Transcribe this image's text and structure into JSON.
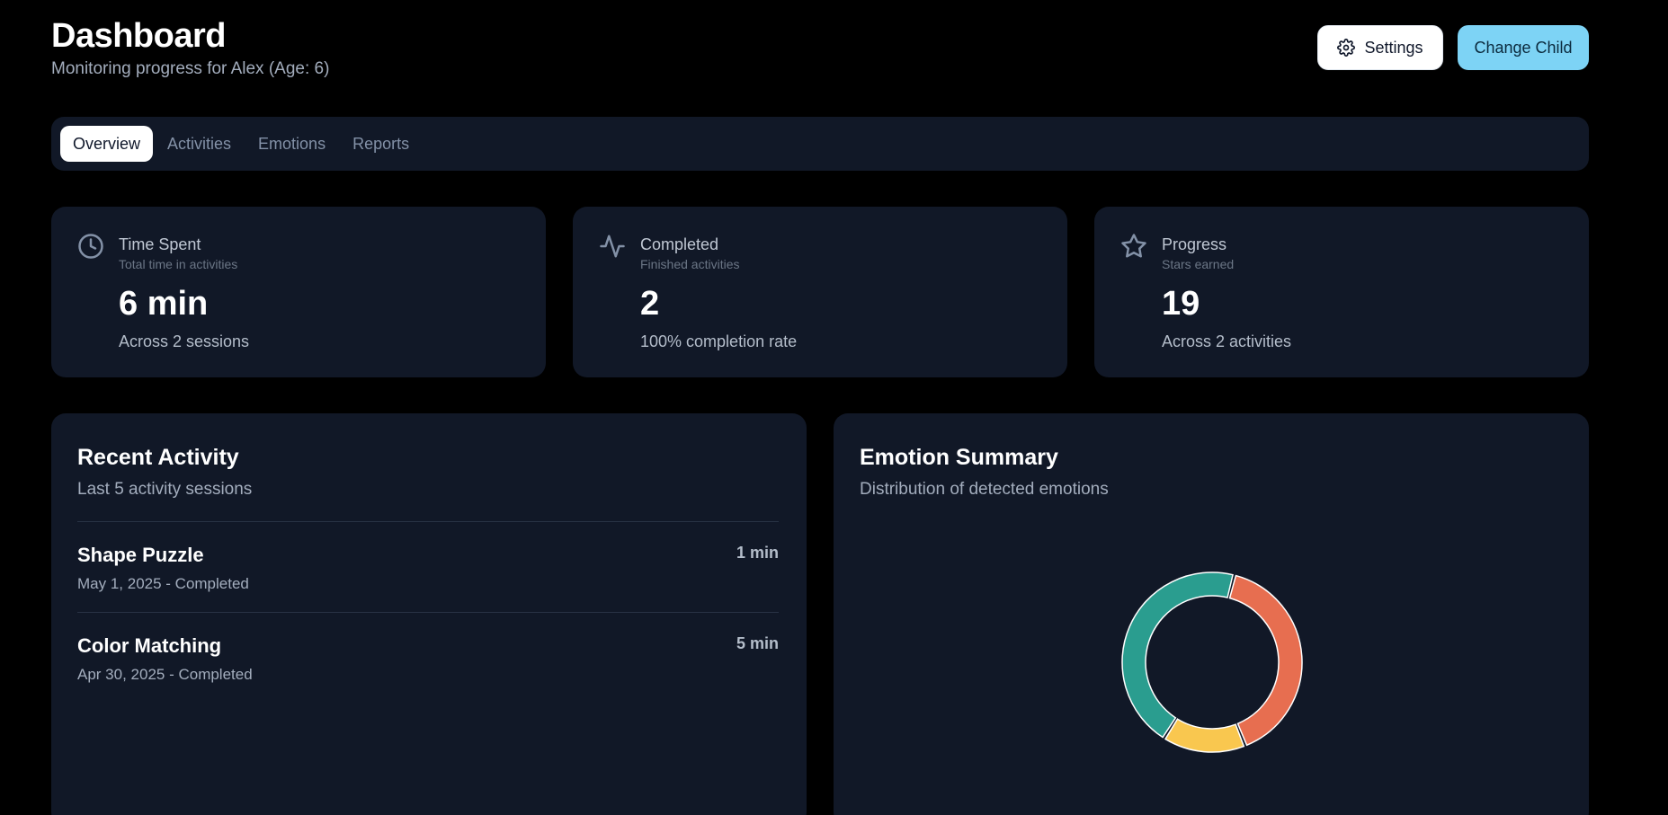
{
  "header": {
    "title": "Dashboard",
    "subtitle": "Monitoring progress for Alex (Age: 6)",
    "settings_label": "Settings",
    "change_child_label": "Change Child"
  },
  "tabs": [
    {
      "label": "Overview",
      "active": true
    },
    {
      "label": "Activities",
      "active": false
    },
    {
      "label": "Emotions",
      "active": false
    },
    {
      "label": "Reports",
      "active": false
    }
  ],
  "stats": [
    {
      "icon": "clock-icon",
      "label": "Time Spent",
      "sublabel": "Total time in activities",
      "value": "6 min",
      "note": "Across 2 sessions"
    },
    {
      "icon": "activity-icon",
      "label": "Completed",
      "sublabel": "Finished activities",
      "value": "2",
      "note": "100% completion rate"
    },
    {
      "icon": "star-icon",
      "label": "Progress",
      "sublabel": "Stars earned",
      "value": "19",
      "note": "Across 2 activities"
    }
  ],
  "recent_activity": {
    "title": "Recent Activity",
    "subtitle": "Last 5 activity sessions",
    "items": [
      {
        "name": "Shape Puzzle",
        "meta": "May 1, 2025 - Completed",
        "duration": "1 min"
      },
      {
        "name": "Color Matching",
        "meta": "Apr 30, 2025 - Completed",
        "duration": "5 min"
      }
    ]
  },
  "emotion_summary": {
    "title": "Emotion Summary",
    "subtitle": "Distribution of detected emotions"
  },
  "chart_data": {
    "type": "pie",
    "values": [
      40,
      15,
      45
    ],
    "colors": [
      "#e76e50",
      "#f9c74f",
      "#2a9d8f"
    ]
  },
  "colors": {
    "background": "#000000",
    "card": "#111827",
    "accent": "#7dd3f5"
  }
}
